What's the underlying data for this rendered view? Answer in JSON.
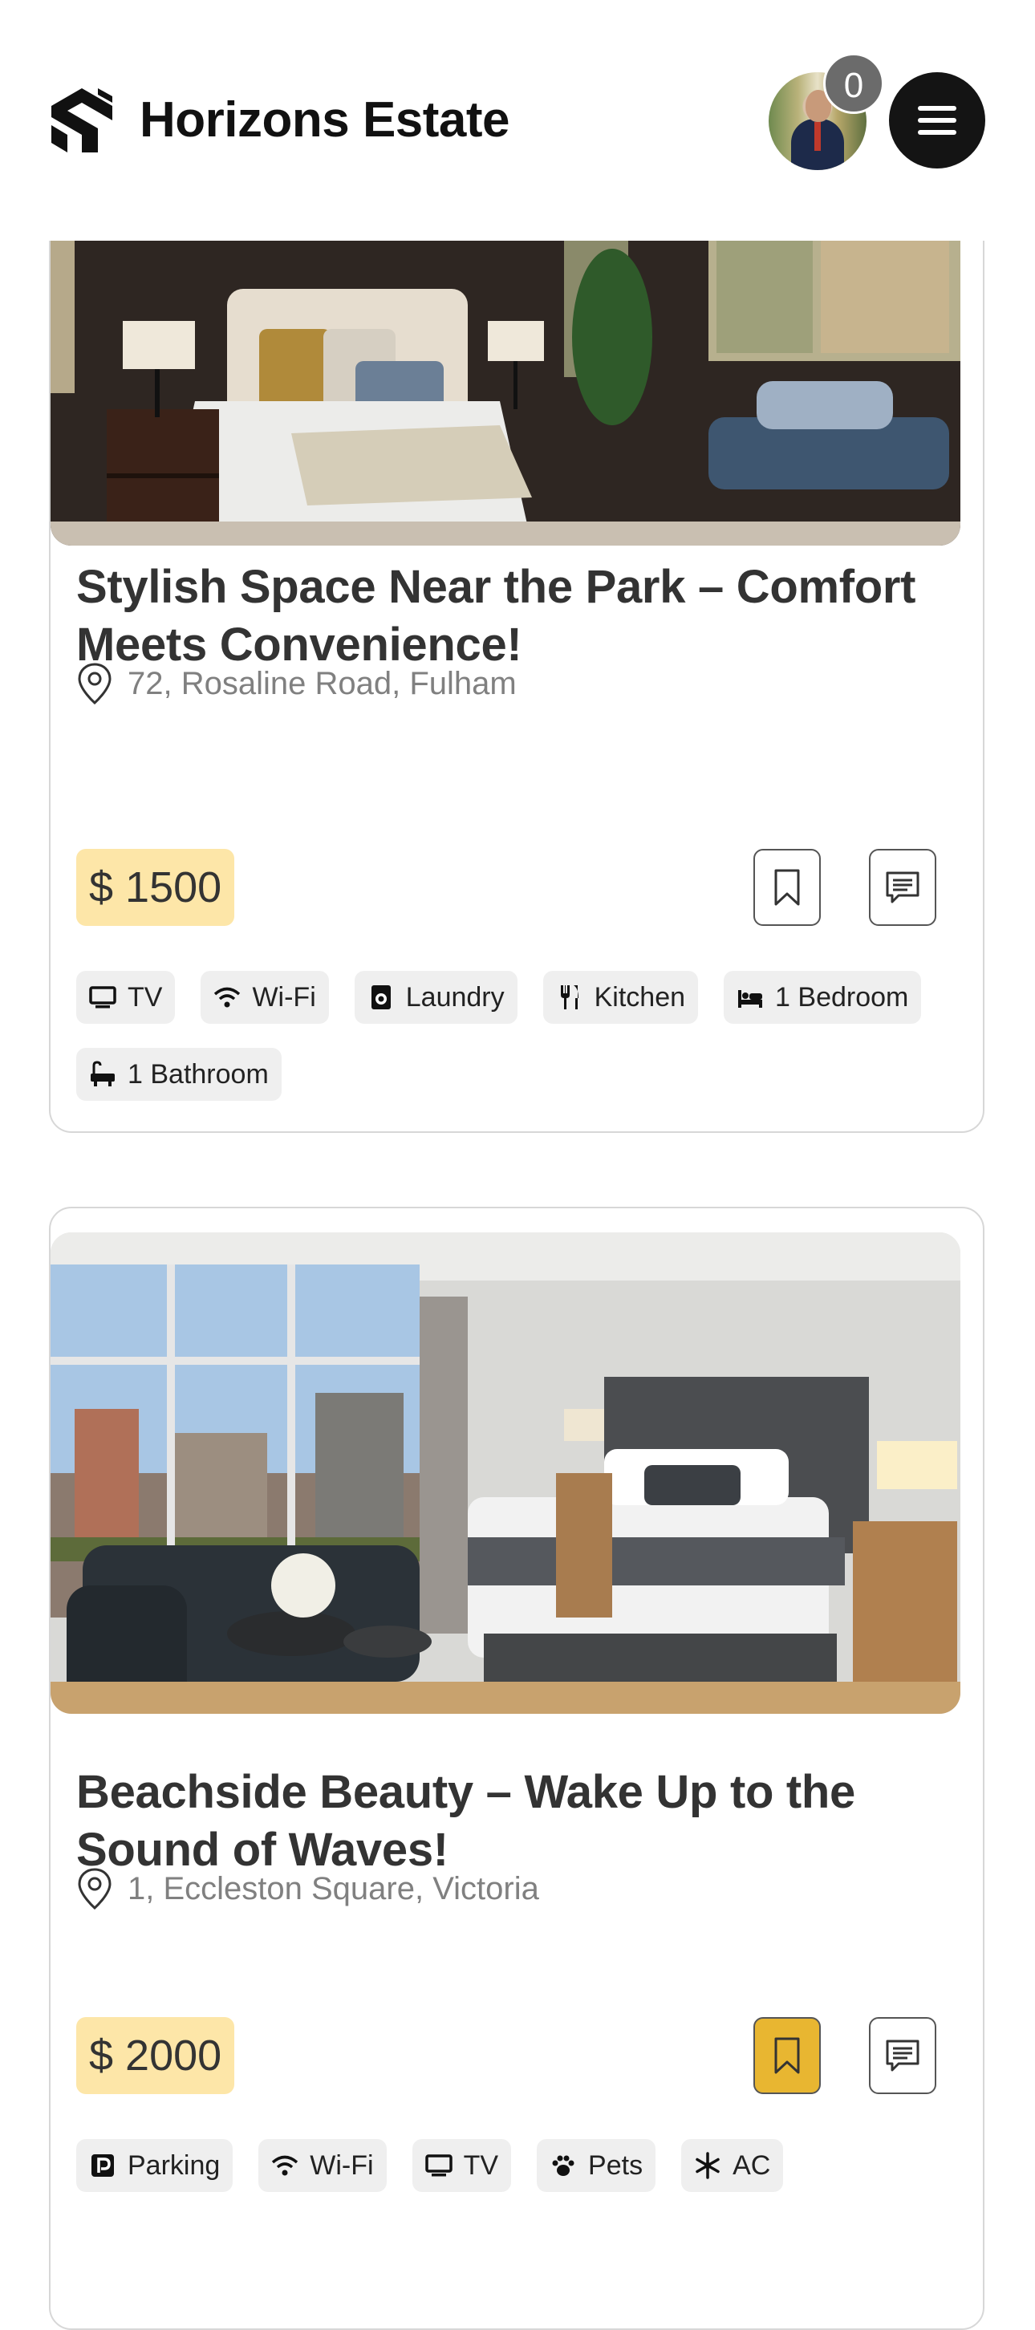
{
  "header": {
    "brand": "Horizons Estate",
    "notification_count": "0"
  },
  "listings": [
    {
      "title": "Stylish Space Near the Park – Comfort Meets Convenience!",
      "location": "72, Rosaline Road, Fulham",
      "price": "$ 1500",
      "saved": false,
      "amenities": [
        {
          "icon": "tv-icon",
          "label": "TV"
        },
        {
          "icon": "wifi-icon",
          "label": "Wi-Fi"
        },
        {
          "icon": "laundry-icon",
          "label": "Laundry"
        },
        {
          "icon": "kitchen-icon",
          "label": "Kitchen"
        },
        {
          "icon": "bed-icon",
          "label": "1 Bedroom"
        },
        {
          "icon": "bath-icon",
          "label": "1 Bathroom"
        }
      ]
    },
    {
      "title": "Beachside Beauty – Wake Up to the Sound of Waves!",
      "location": "1, Eccleston Square, Victoria",
      "price": "$ 2000",
      "saved": true,
      "amenities": [
        {
          "icon": "parking-icon",
          "label": "Parking"
        },
        {
          "icon": "wifi-icon",
          "label": "Wi-Fi"
        },
        {
          "icon": "tv-icon",
          "label": "TV"
        },
        {
          "icon": "paw-icon",
          "label": "Pets"
        },
        {
          "icon": "snowflake-icon",
          "label": "AC"
        }
      ]
    }
  ],
  "colors": {
    "price_bg": "#fde6a8",
    "saved_accent": "#e8b631",
    "menu_bg": "#141414",
    "badge_bg": "#6b6b6b"
  }
}
